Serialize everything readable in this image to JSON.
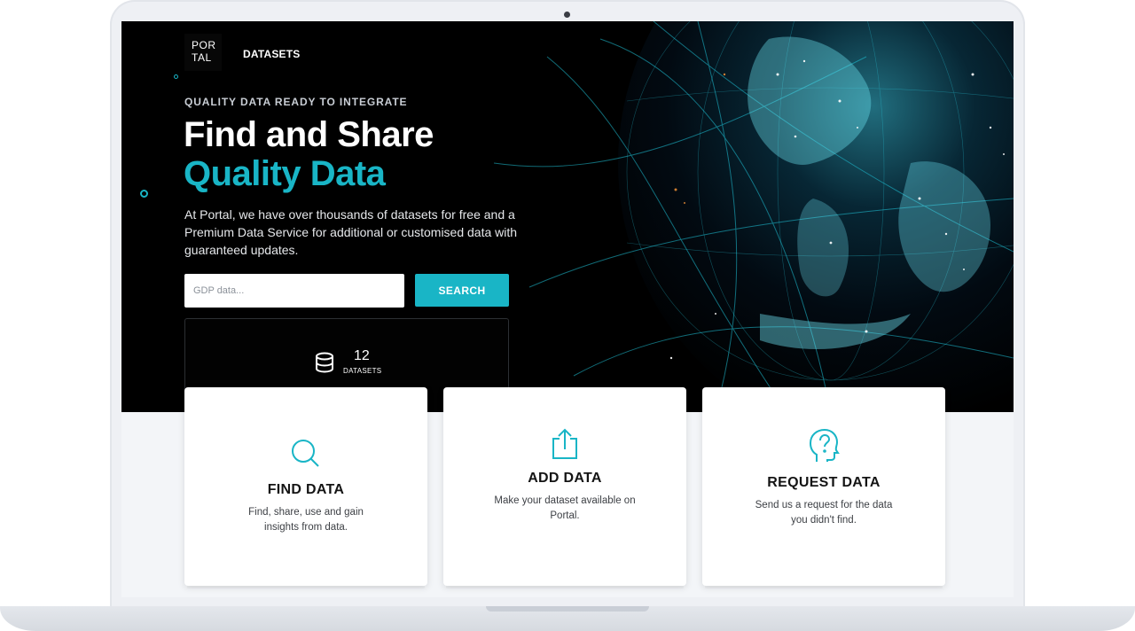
{
  "nav": {
    "logo_line1": "POR",
    "logo_line2": "TAL",
    "datasets_link": "DATASETS"
  },
  "hero": {
    "eyebrow": "QUALITY DATA READY TO INTEGRATE",
    "headline_line1": "Find and Share",
    "headline_line2": "Quality Data",
    "intro": "At Portal, we have over thousands of datasets for free and a Premium Data Service for additional or customised data with guaranteed updates."
  },
  "search": {
    "placeholder": "GDP data...",
    "button_label": "SEARCH"
  },
  "stats": {
    "icon": "database-icon",
    "value": "12",
    "label": "DATASETS"
  },
  "cards": [
    {
      "icon": "search-icon",
      "title": "FIND DATA",
      "text": "Find, share, use and gain insights from data."
    },
    {
      "icon": "upload-icon",
      "title": "ADD DATA",
      "text": "Make your dataset available on Portal."
    },
    {
      "icon": "question-head-icon",
      "title": "REQUEST DATA",
      "text": "Send us a request for the data you didn't find."
    }
  ],
  "colors": {
    "accent": "#19b5c6",
    "hero_background": "#000000",
    "page_background": "#f3f5f8"
  }
}
